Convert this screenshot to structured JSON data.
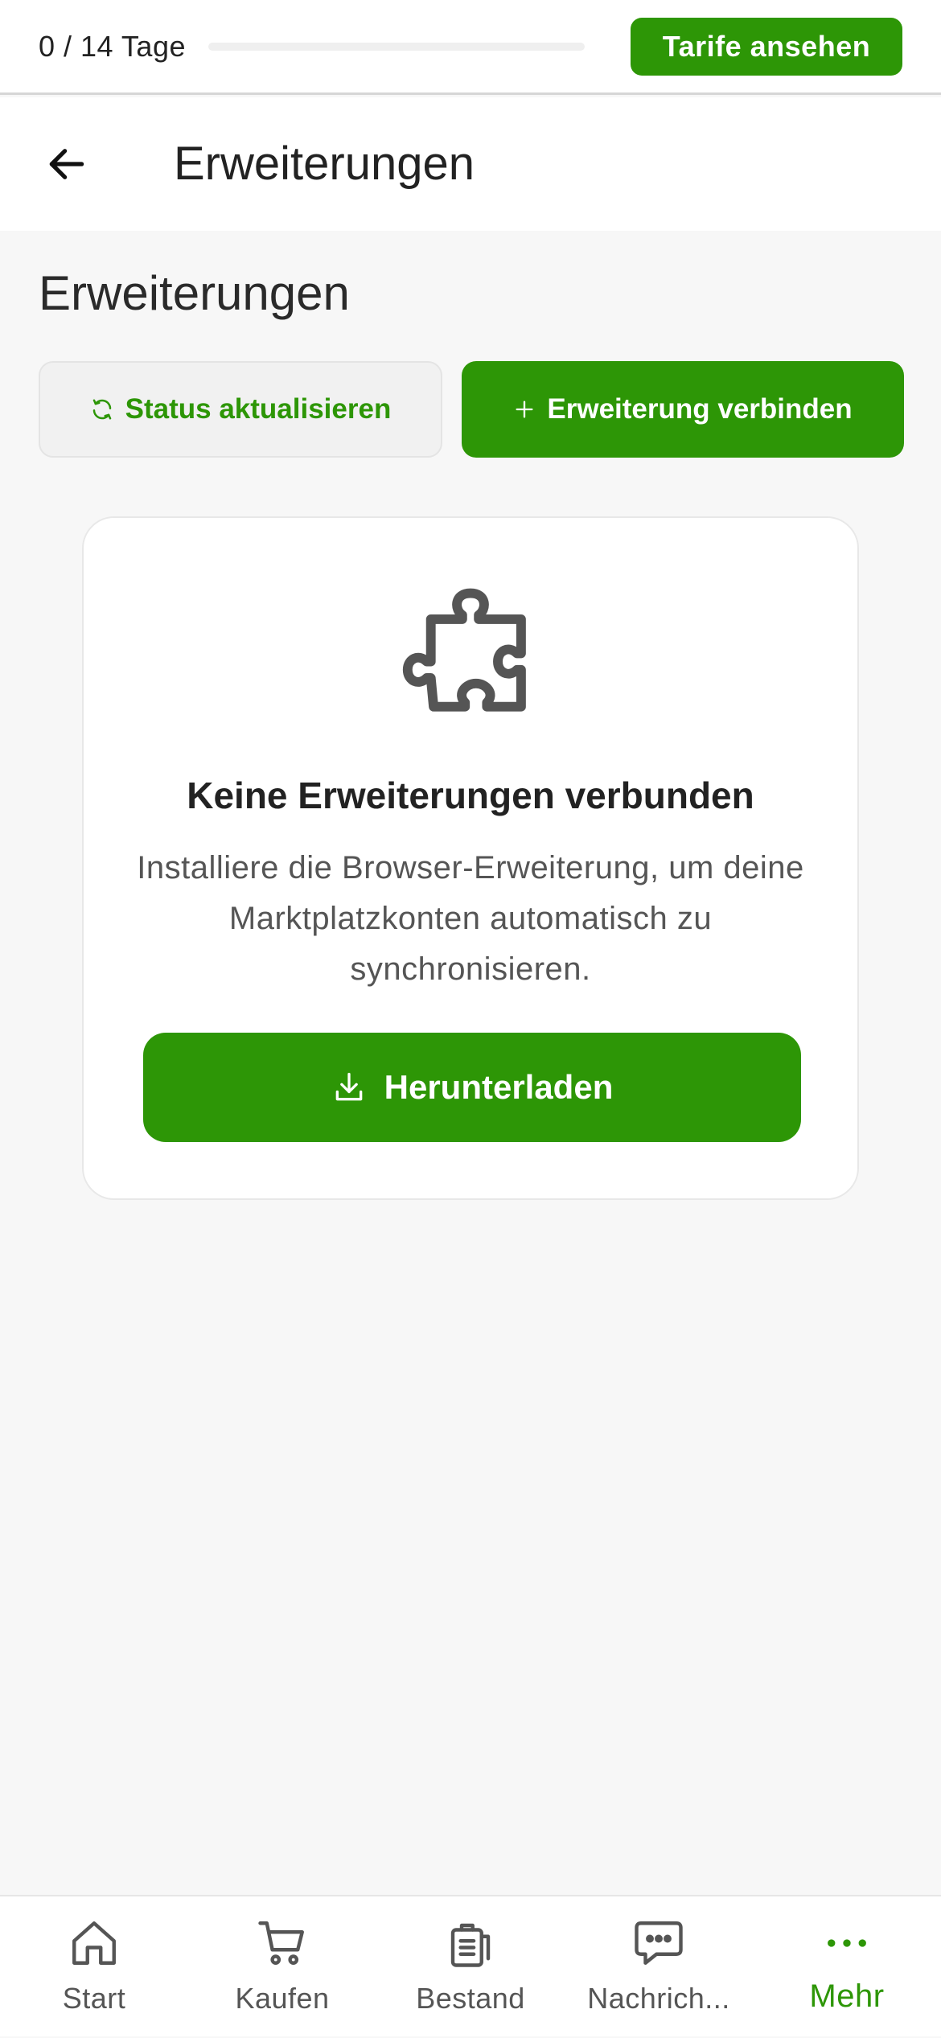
{
  "trial": {
    "label": "0 / 14 Tage",
    "progress": 0,
    "cta_label": "Tarife ansehen"
  },
  "header": {
    "back_icon": "arrow-left-icon",
    "title": "Erweiterungen"
  },
  "page": {
    "heading": "Erweiterungen",
    "refresh_label": "Status aktualisieren",
    "refresh_icon": "refresh-icon",
    "connect_label": "Erweiterung verbinden",
    "connect_icon": "plus-icon"
  },
  "empty_state": {
    "icon": "puzzle-icon",
    "title": "Keine Erweiterungen verbunden",
    "description": "Installiere die Browser-Erweiterung, um deine Marktplatzkonten automatisch zu synchronisieren.",
    "download_label": "Herunterladen",
    "download_icon": "download-icon"
  },
  "bottom_nav": {
    "items": [
      {
        "label": "Start",
        "icon": "home-icon"
      },
      {
        "label": "Kaufen",
        "icon": "cart-icon"
      },
      {
        "label": "Bestand",
        "icon": "clipboard-icon"
      },
      {
        "label": "Nachrich...",
        "icon": "chat-icon"
      },
      {
        "label": "Mehr",
        "icon": "more-icon",
        "active": true
      }
    ]
  },
  "colors": {
    "accent": "#2d9606",
    "background": "#f7f7f7",
    "card": "#ffffff"
  }
}
